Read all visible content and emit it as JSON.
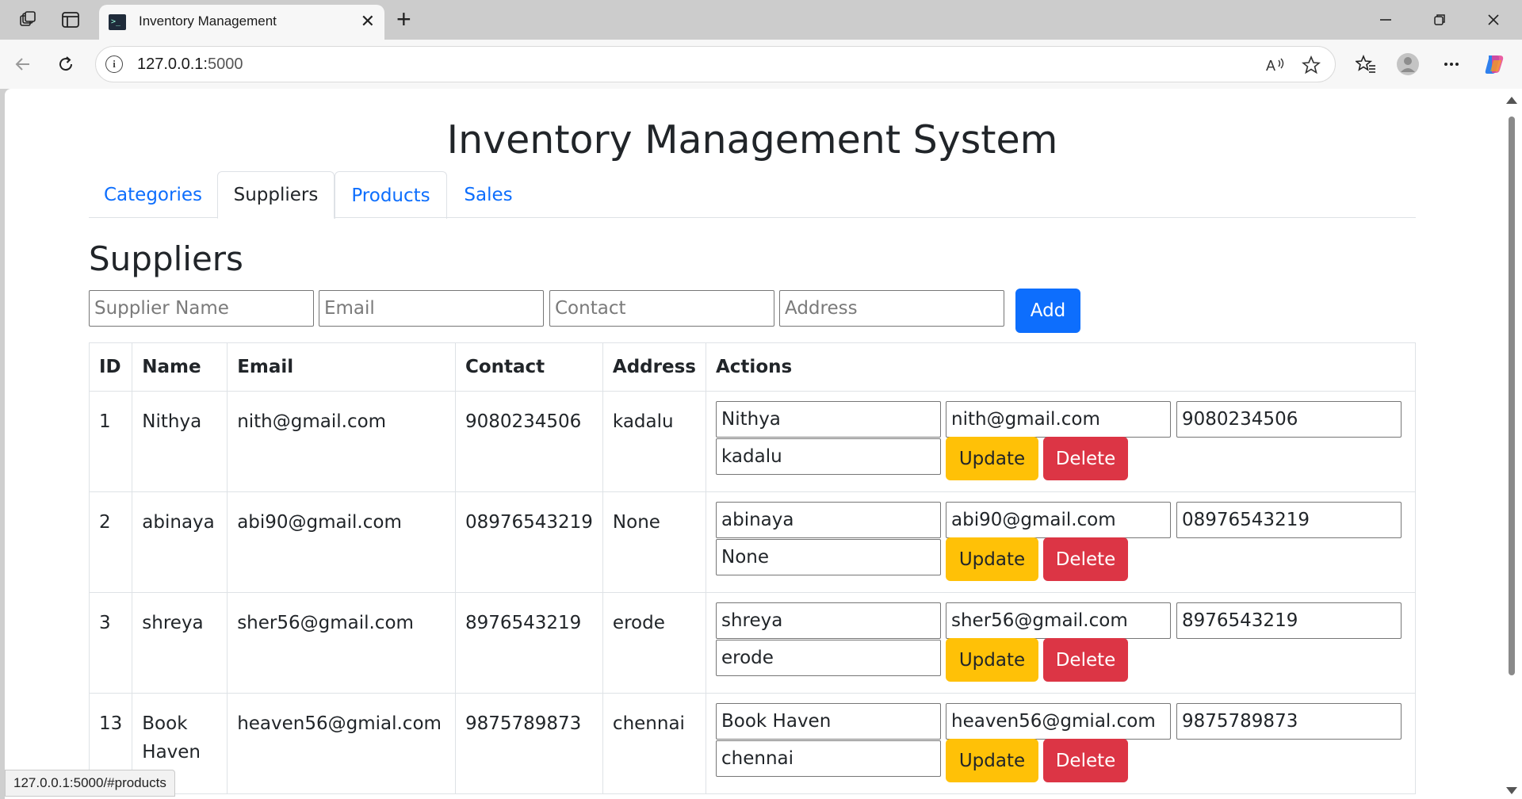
{
  "browser": {
    "tab_title": "Inventory Management",
    "url_host": "127.0.0.1:",
    "url_port": "5000",
    "status_url": "127.0.0.1:5000/#products"
  },
  "page": {
    "title": "Inventory Management System",
    "nav_tabs": [
      "Categories",
      "Suppliers",
      "Products",
      "Sales"
    ],
    "active_tab": "Suppliers",
    "section_title": "Suppliers"
  },
  "add_form": {
    "name_placeholder": "Supplier Name",
    "email_placeholder": "Email",
    "contact_placeholder": "Contact",
    "address_placeholder": "Address",
    "add_label": "Add"
  },
  "table": {
    "headers": [
      "ID",
      "Name",
      "Email",
      "Contact",
      "Address",
      "Actions"
    ],
    "rows": [
      {
        "id": "1",
        "name": "Nithya",
        "email": "nith@gmail.com",
        "contact": "9080234506",
        "address": "kadalu"
      },
      {
        "id": "2",
        "name": "abinaya",
        "email": "abi90@gmail.com",
        "contact": "08976543219",
        "address": "None"
      },
      {
        "id": "3",
        "name": "shreya",
        "email": "sher56@gmail.com",
        "contact": "8976543219",
        "address": "erode"
      },
      {
        "id": "13",
        "name": "Book Haven",
        "email": "heaven56@gmial.com",
        "contact": "9875789873",
        "address": "chennai"
      }
    ],
    "update_label": "Update",
    "delete_label": "Delete"
  },
  "colors": {
    "primary": "#0d6efd",
    "warning": "#ffc107",
    "danger": "#dc3545",
    "text": "#212529"
  }
}
